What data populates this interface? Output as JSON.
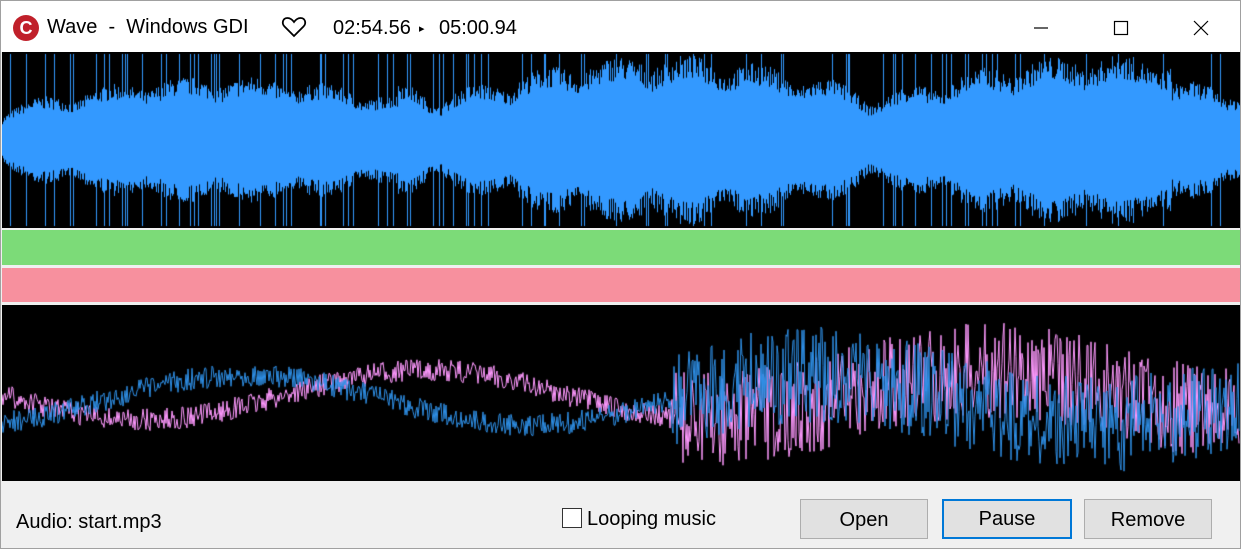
{
  "window": {
    "app_icon_letter": "C",
    "title": "Wave  -  Windows GDI",
    "current_time": "02:54.56",
    "play_indicator": "▸",
    "total_time": "05:00.94",
    "icons": [
      "app-icon",
      "heart-icon",
      "minimize-icon",
      "maximize-icon",
      "close-icon"
    ]
  },
  "colors": {
    "wave_top": "#3399ff",
    "wave_bottom_a": "#ff99ff",
    "wave_bottom_b": "#2e8fe6",
    "level_green": "#7cdb78",
    "level_red": "#f7909e",
    "accent": "#0078d7"
  },
  "footer": {
    "audio_label": "Audio: start.mp3",
    "looping_label": "Looping music",
    "looping_checked": false,
    "open_label": "Open",
    "pause_label": "Pause",
    "remove_label": "Remove"
  }
}
